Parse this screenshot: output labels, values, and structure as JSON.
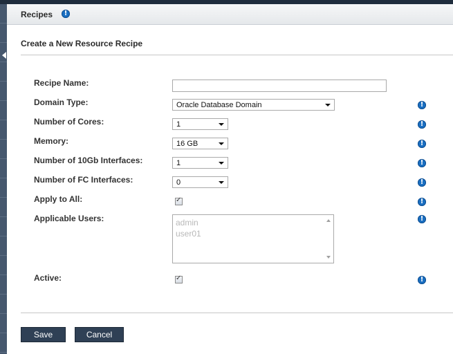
{
  "header": {
    "title": "Recipes"
  },
  "form": {
    "title": "Create a New Resource Recipe",
    "fields": {
      "recipe_name": {
        "label": "Recipe Name:",
        "value": ""
      },
      "domain_type": {
        "label": "Domain Type:",
        "value": "Oracle Database Domain"
      },
      "cores": {
        "label": "Number of Cores:",
        "value": "1"
      },
      "memory": {
        "label": "Memory:",
        "value": "16 GB"
      },
      "ten_gb": {
        "label": "Number of 10Gb Interfaces:",
        "value": "1"
      },
      "fc": {
        "label": "Number of FC Interfaces:",
        "value": "0"
      },
      "apply_all": {
        "label": "Apply to All:",
        "checked": true
      },
      "users": {
        "label": "Applicable Users:",
        "options": [
          "admin",
          "user01"
        ]
      },
      "active": {
        "label": "Active:",
        "checked": true
      }
    }
  },
  "buttons": {
    "save": "Save",
    "cancel": "Cancel"
  },
  "icons": {
    "info": "info-icon",
    "info_glyph": "!",
    "check_glyph": "✓",
    "collapse": "chevron-left-icon"
  },
  "colors": {
    "accent": "#1a6fc2",
    "button": "#2f4055",
    "nav": "#46586e"
  }
}
